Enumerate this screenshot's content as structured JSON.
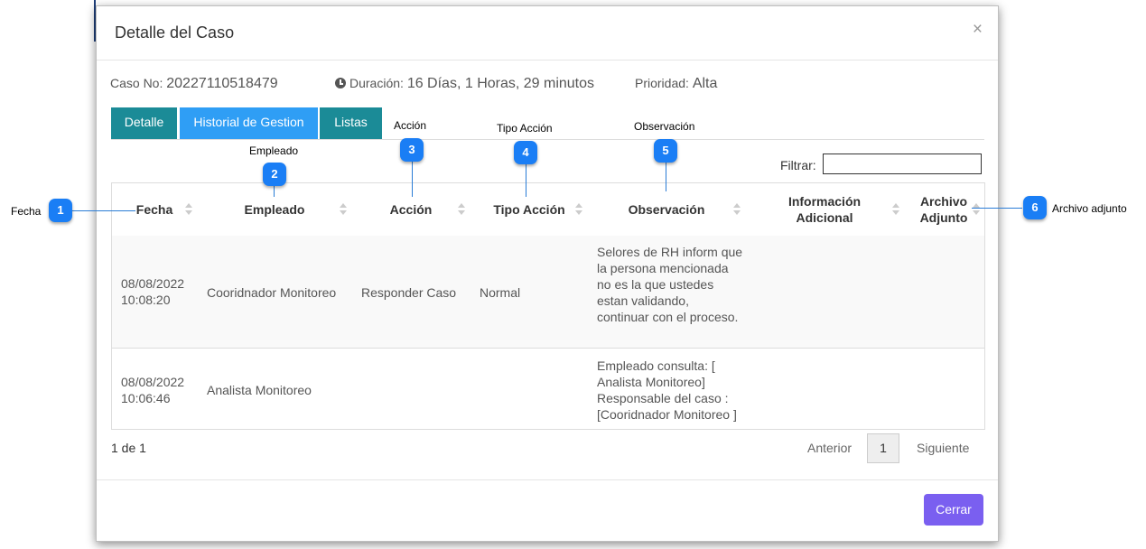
{
  "modal": {
    "title": "Detalle del Caso",
    "close": "×"
  },
  "info": {
    "case_label": "Caso No:",
    "case_value": "20227110518479",
    "duration_label": "Duración:",
    "duration_value": "16 Días, 1 Horas, 29 minutos",
    "priority_label": "Prioridad:",
    "priority_value": "Alta"
  },
  "tabs": [
    "Detalle",
    "Historial de Gestion",
    "Listas"
  ],
  "filter": {
    "label": "Filtrar:",
    "value": ""
  },
  "table": {
    "headers": [
      "Fecha",
      "Empleado",
      "Acción",
      "Tipo Acción",
      "Observación",
      "Información Adicional",
      "Archivo Adjunto"
    ],
    "rows": [
      {
        "fecha": "08/08/2022 10:08:20",
        "empleado": "Cooridnador Monitoreo",
        "accion": "Responder Caso",
        "tipo": "Normal",
        "observacion": "Selores de RH inform que la persona mencionada no es la que ustedes estan validando, continuar con el proceso.",
        "info": "",
        "archivo": ""
      },
      {
        "fecha": "08/08/2022 10:06:46",
        "empleado": "Analista Monitoreo",
        "accion": "",
        "tipo": "",
        "observacion": "Empleado consulta: [ Analista Monitoreo] Responsable del caso : [Cooridnador Monitoreo ]",
        "info": "",
        "archivo": ""
      }
    ]
  },
  "pagination": {
    "info": "1 de 1",
    "prev": "Anterior",
    "page": "1",
    "next": "Siguiente"
  },
  "footer": {
    "close_button": "Cerrar"
  },
  "annotations": [
    {
      "num": "1",
      "label": "Fecha"
    },
    {
      "num": "2",
      "label": "Empleado"
    },
    {
      "num": "3",
      "label": "Acción"
    },
    {
      "num": "4",
      "label": "Tipo Acción"
    },
    {
      "num": "5",
      "label": "Observación"
    },
    {
      "num": "6",
      "label": "Archivo adjunto"
    }
  ],
  "colors": {
    "tab_teal": "#1b8b97",
    "tab_active": "#2f9ef5",
    "primary_button": "#7a5ff0",
    "badge": "#1a7ef5"
  }
}
